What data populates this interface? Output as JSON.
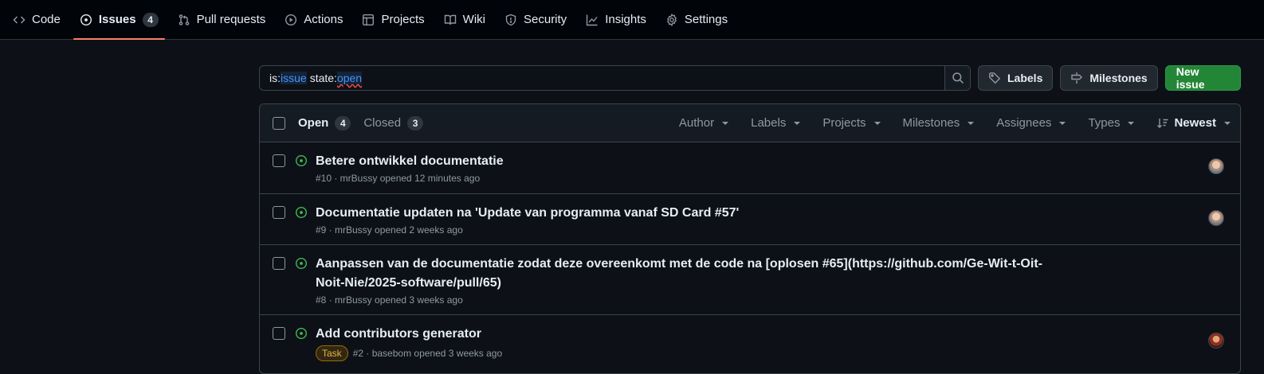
{
  "nav": {
    "items": [
      {
        "label": "Code",
        "icon": "code-icon"
      },
      {
        "label": "Issues",
        "icon": "issue-opened-icon",
        "count": "4",
        "selected": true
      },
      {
        "label": "Pull requests",
        "icon": "git-pull-request-icon"
      },
      {
        "label": "Actions",
        "icon": "play-icon"
      },
      {
        "label": "Projects",
        "icon": "table-icon"
      },
      {
        "label": "Wiki",
        "icon": "book-icon"
      },
      {
        "label": "Security",
        "icon": "shield-icon"
      },
      {
        "label": "Insights",
        "icon": "graph-icon"
      },
      {
        "label": "Settings",
        "icon": "gear-icon"
      }
    ]
  },
  "search": {
    "q1_key": "is:",
    "q1_val": "issue",
    "q2_key": "state:",
    "q2_val": "open"
  },
  "buttons": {
    "labels": "Labels",
    "milestones": "Milestones",
    "new_issue": "New issue"
  },
  "list_header": {
    "open_label": "Open",
    "open_count": "4",
    "closed_label": "Closed",
    "closed_count": "3",
    "filters": [
      "Author",
      "Labels",
      "Projects",
      "Milestones",
      "Assignees",
      "Types"
    ],
    "sort": "Newest"
  },
  "issues": [
    {
      "title": "Betere ontwikkel documentatie",
      "meta": "#10 · mrBussy opened 12 minutes ago",
      "label": ""
    },
    {
      "title": "Documentatie updaten na 'Update van programma vanaf SD Card #57'",
      "meta": "#9 · mrBussy opened 2 weeks ago",
      "label": ""
    },
    {
      "title": "Aanpassen van de documentatie zodat deze overeenkomt met de code na [oplosen #65](https://github.com/Ge-Wit-t-Oit-Noit-Nie/2025-software/pull/65)",
      "meta": "#8 · mrBussy opened 3 weeks ago",
      "label": ""
    },
    {
      "title": "Add contributors generator",
      "meta": "#2 · basebom opened 3 weeks ago",
      "label": "Task"
    }
  ],
  "colors": {
    "accent_underline": "#f78166",
    "open_icon": "#3fb950",
    "primary_button": "#238636",
    "task_label": "#e3b341"
  }
}
